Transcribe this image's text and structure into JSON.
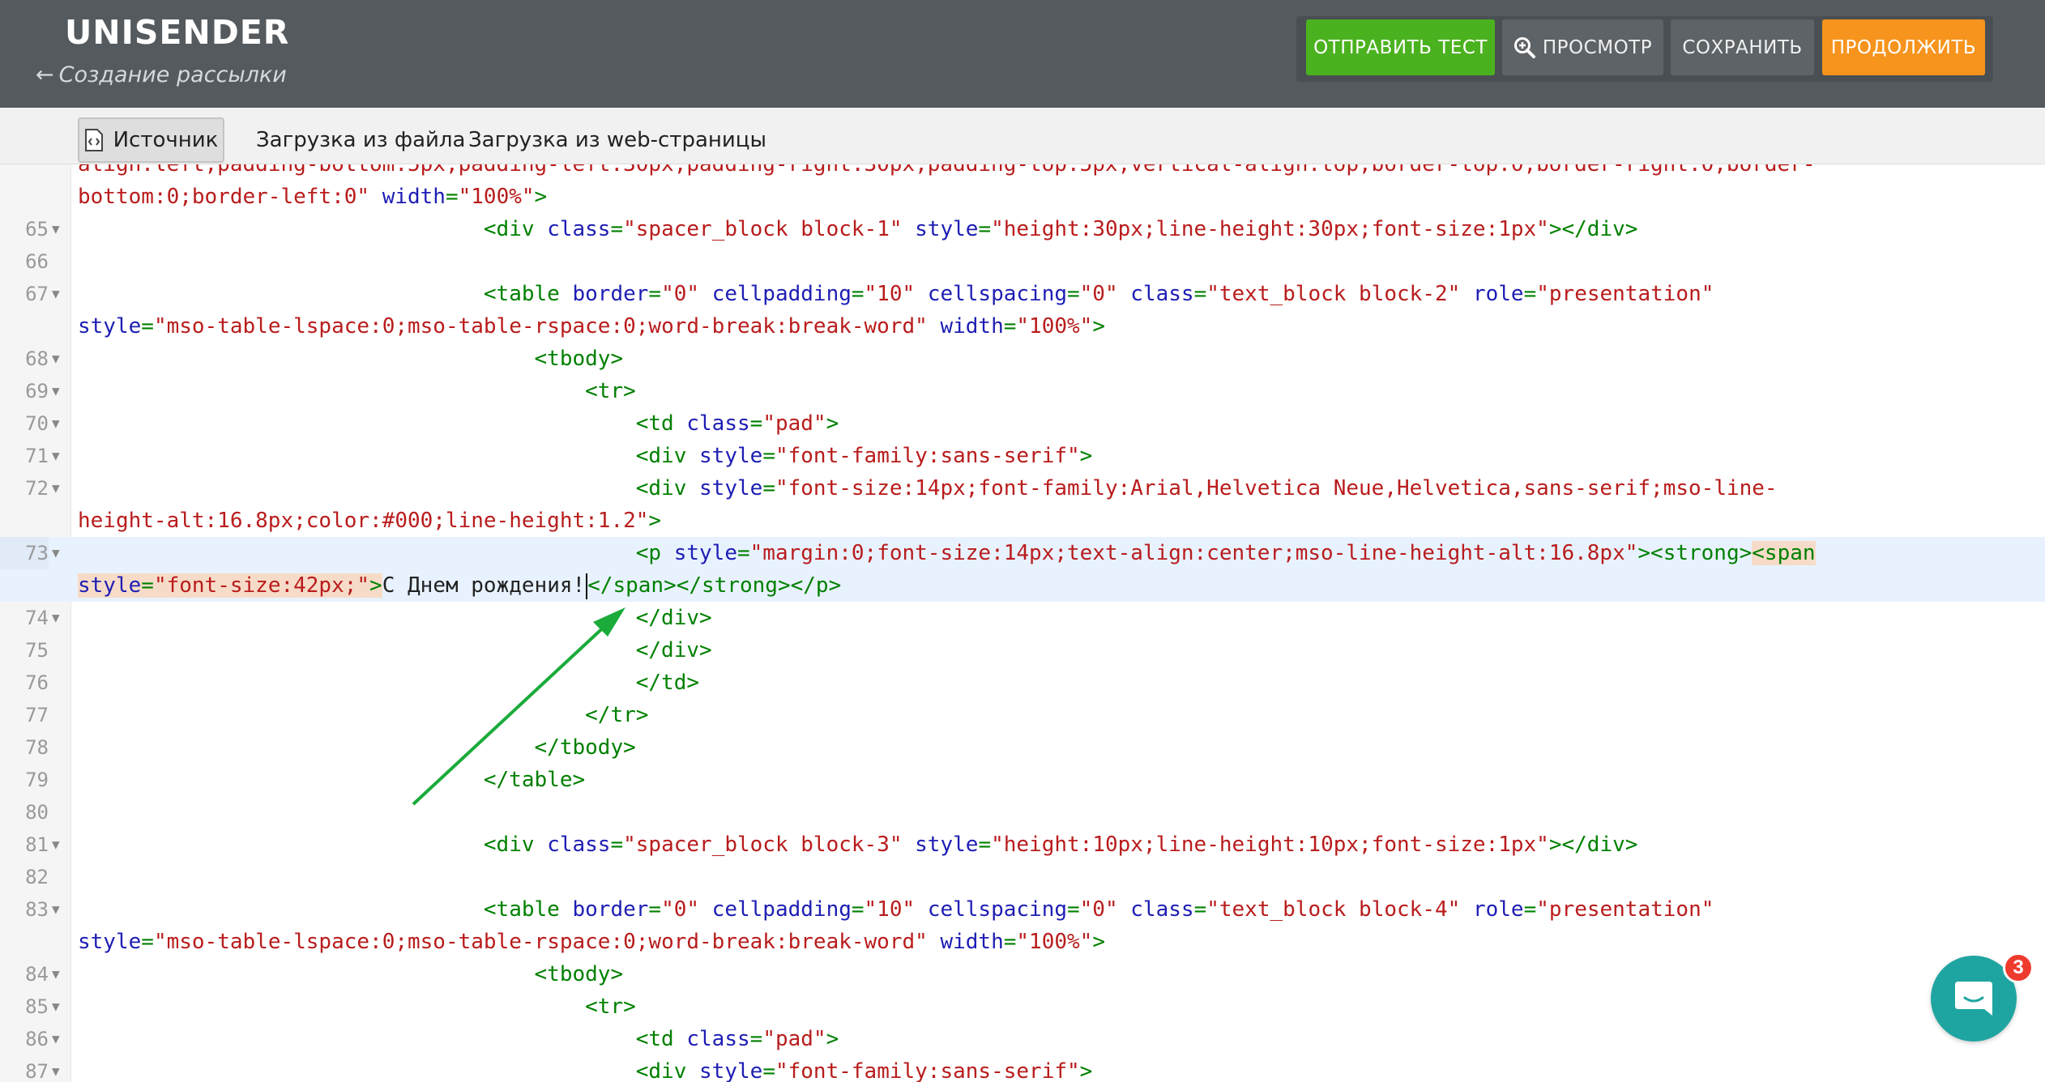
{
  "header": {
    "logo": "UNISENDER",
    "back_arrow": "←",
    "subtitle": "Создание рассылки",
    "buttons": {
      "send_test": "ОТПРАВИТЬ ТЕСТ",
      "preview": "ПРОСМОТР",
      "save": "СОХРАНИТЬ",
      "continue": "ПРОДОЛЖИТЬ"
    }
  },
  "tabs": {
    "source": "Источник",
    "from_file": "Загрузка из файла",
    "from_web": "Загрузка из web-страницы"
  },
  "editor": {
    "lines": [
      {
        "num": "",
        "fold": false,
        "html": "<span class=\"val\">align:left;padding-bottom:5px;padding-left:30px;padding-right:30px;padding-top:5px;vertical-align:top;border-top:0;border-right:0;border-</span>"
      },
      {
        "num": "",
        "fold": false,
        "html": "<span class=\"val\">bottom:0;border-left:0\"</span> <span class=\"attr\">width</span><span class=\"tag\">=</span><span class=\"val\">\"100%\"</span><span class=\"tag\">&gt;</span>"
      },
      {
        "num": "65",
        "fold": true,
        "html": "                                <span class=\"tag\">&lt;div</span> <span class=\"attr\">class</span><span class=\"tag\">=</span><span class=\"val\">\"spacer_block block-1\"</span> <span class=\"attr\">style</span><span class=\"tag\">=</span><span class=\"val\">\"height:30px;line-height:30px;font-size:1px\"</span><span class=\"tag\">&gt;&lt;/div&gt;</span>"
      },
      {
        "num": "66",
        "fold": false,
        "html": ""
      },
      {
        "num": "67",
        "fold": true,
        "html": "                                <span class=\"tag\">&lt;table</span> <span class=\"attr\">border</span><span class=\"tag\">=</span><span class=\"val\">\"0\"</span> <span class=\"attr\">cellpadding</span><span class=\"tag\">=</span><span class=\"val\">\"10\"</span> <span class=\"attr\">cellspacing</span><span class=\"tag\">=</span><span class=\"val\">\"0\"</span> <span class=\"attr\">class</span><span class=\"tag\">=</span><span class=\"val\">\"text_block block-2\"</span> <span class=\"attr\">role</span><span class=\"tag\">=</span><span class=\"val\">\"presentation\"</span>"
      },
      {
        "num": "",
        "fold": false,
        "html": "<span class=\"attr\">style</span><span class=\"tag\">=</span><span class=\"val\">\"mso-table-lspace:0;mso-table-rspace:0;word-break:break-word\"</span> <span class=\"attr\">width</span><span class=\"tag\">=</span><span class=\"val\">\"100%\"</span><span class=\"tag\">&gt;</span>"
      },
      {
        "num": "68",
        "fold": true,
        "html": "                                    <span class=\"tag\">&lt;tbody&gt;</span>"
      },
      {
        "num": "69",
        "fold": true,
        "html": "                                        <span class=\"tag\">&lt;tr&gt;</span>"
      },
      {
        "num": "70",
        "fold": true,
        "html": "                                            <span class=\"tag\">&lt;td</span> <span class=\"attr\">class</span><span class=\"tag\">=</span><span class=\"val\">\"pad\"</span><span class=\"tag\">&gt;</span>"
      },
      {
        "num": "71",
        "fold": true,
        "html": "                                            <span class=\"tag\">&lt;div</span> <span class=\"attr\">style</span><span class=\"tag\">=</span><span class=\"val\">\"font-family:sans-serif\"</span><span class=\"tag\">&gt;</span>"
      },
      {
        "num": "72",
        "fold": true,
        "html": "                                            <span class=\"tag\">&lt;div</span> <span class=\"attr\">style</span><span class=\"tag\">=</span><span class=\"val\">\"font-size:14px;font-family:Arial,Helvetica Neue,Helvetica,sans-serif;mso-line-</span>"
      },
      {
        "num": "",
        "fold": false,
        "html": "<span class=\"val\">height-alt:16.8px;color:#000;line-height:1.2\"</span><span class=\"tag\">&gt;</span>"
      },
      {
        "num": "73",
        "fold": true,
        "active": true,
        "html": "                                            <span class=\"tag\">&lt;p</span> <span class=\"attr\">style</span><span class=\"tag\">=</span><span class=\"val\">\"margin:0;font-size:14px;text-align:center;mso-line-height-alt:16.8px\"</span><span class=\"tag\">&gt;&lt;strong&gt;</span><span class=\"hl\"><span class=\"tag\">&lt;span</span></span>"
      },
      {
        "num": "",
        "fold": false,
        "active": true,
        "html": "<span class=\"hl\"><span class=\"attr\">style</span><span class=\"tag\">=</span><span class=\"val\">\"font-size:42px;\"</span><span class=\"tag\">&gt;</span></span><span class=\"txt\">С Днем рождения!</span><span class=\"cursor\"></span><span class=\"tag\">&lt;/span&gt;&lt;/strong&gt;&lt;/p&gt;</span>"
      },
      {
        "num": "74",
        "fold": true,
        "html": "                                            <span class=\"tag\">&lt;/div&gt;</span>"
      },
      {
        "num": "75",
        "fold": false,
        "html": "                                            <span class=\"tag\">&lt;/div&gt;</span>"
      },
      {
        "num": "76",
        "fold": false,
        "html": "                                            <span class=\"tag\">&lt;/td&gt;</span>"
      },
      {
        "num": "77",
        "fold": false,
        "html": "                                        <span class=\"tag\">&lt;/tr&gt;</span>"
      },
      {
        "num": "78",
        "fold": false,
        "html": "                                    <span class=\"tag\">&lt;/tbody&gt;</span>"
      },
      {
        "num": "79",
        "fold": false,
        "html": "                                <span class=\"tag\">&lt;/table&gt;</span>"
      },
      {
        "num": "80",
        "fold": false,
        "html": ""
      },
      {
        "num": "81",
        "fold": true,
        "html": "                                <span class=\"tag\">&lt;div</span> <span class=\"attr\">class</span><span class=\"tag\">=</span><span class=\"val\">\"spacer_block block-3\"</span> <span class=\"attr\">style</span><span class=\"tag\">=</span><span class=\"val\">\"height:10px;line-height:10px;font-size:1px\"</span><span class=\"tag\">&gt;&lt;/div&gt;</span>"
      },
      {
        "num": "82",
        "fold": false,
        "html": ""
      },
      {
        "num": "83",
        "fold": true,
        "html": "                                <span class=\"tag\">&lt;table</span> <span class=\"attr\">border</span><span class=\"tag\">=</span><span class=\"val\">\"0\"</span> <span class=\"attr\">cellpadding</span><span class=\"tag\">=</span><span class=\"val\">\"10\"</span> <span class=\"attr\">cellspacing</span><span class=\"tag\">=</span><span class=\"val\">\"0\"</span> <span class=\"attr\">class</span><span class=\"tag\">=</span><span class=\"val\">\"text_block block-4\"</span> <span class=\"attr\">role</span><span class=\"tag\">=</span><span class=\"val\">\"presentation\"</span>"
      },
      {
        "num": "",
        "fold": false,
        "html": "<span class=\"attr\">style</span><span class=\"tag\">=</span><span class=\"val\">\"mso-table-lspace:0;mso-table-rspace:0;word-break:break-word\"</span> <span class=\"attr\">width</span><span class=\"tag\">=</span><span class=\"val\">\"100%\"</span><span class=\"tag\">&gt;</span>"
      },
      {
        "num": "84",
        "fold": true,
        "html": "                                    <span class=\"tag\">&lt;tbody&gt;</span>"
      },
      {
        "num": "85",
        "fold": true,
        "html": "                                        <span class=\"tag\">&lt;tr&gt;</span>"
      },
      {
        "num": "86",
        "fold": true,
        "html": "                                            <span class=\"tag\">&lt;td</span> <span class=\"attr\">class</span><span class=\"tag\">=</span><span class=\"val\">\"pad\"</span><span class=\"tag\">&gt;</span>"
      },
      {
        "num": "87",
        "fold": true,
        "html": "                                            <span class=\"tag\">&lt;div</span> <span class=\"attr\">style</span><span class=\"tag\">=</span><span class=\"val\">\"font-family:sans-serif\"</span><span class=\"tag\">&gt;</span>"
      }
    ]
  },
  "chat": {
    "badge_count": "3"
  },
  "colors": {
    "header_bg": "#545a5e",
    "test_green": "#4bb21f",
    "continue_orange": "#f7941d",
    "tag_green": "#008000",
    "attr_blue": "#1e1eb4",
    "value_red": "#b91c1c",
    "chat_teal": "#1fa5a1",
    "annotation_arrow": "#1aab3a"
  }
}
